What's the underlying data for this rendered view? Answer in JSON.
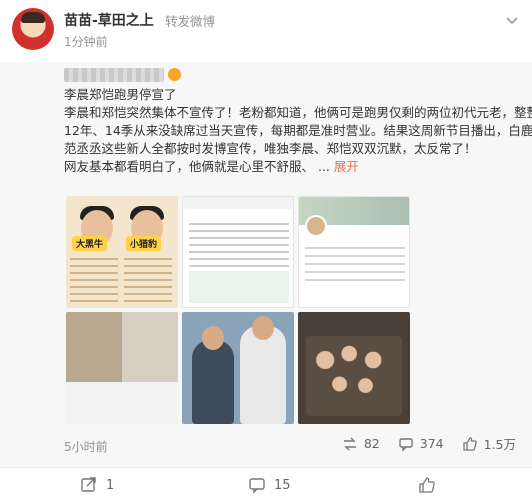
{
  "header": {
    "username": "苗苗-草田之上",
    "repost_label": "转发微博",
    "time": "1分钟前"
  },
  "original": {
    "text_lines": [
      "李晨郑恺跑男停宣了",
      "李晨和郑恺突然集体不宣传了！老粉都知道，他俩可是跑男仅剩的两位初代元老，整整",
      "12年、14季从来没缺席过当天宣传，每期都是准时营业。结果这周新节目播出，白鹿、",
      "范丞丞这些新人全都按时发博宣传，唯独李晨、郑恺双双沉默，太反常了！",
      "网友基本都看明白了，他俩就是心里不舒服、 ..."
    ],
    "expand_label": "展开",
    "thumb1_label_left": "大黑牛",
    "thumb1_label_right": "小猎豹",
    "time": "5小时前",
    "reposts": "82",
    "comments": "374",
    "likes": "1.5万"
  },
  "footer": {
    "repost_count": "1",
    "comment_count": "15"
  },
  "icons": [
    "more-icon",
    "repost-icon",
    "comment-icon",
    "like-icon"
  ],
  "colors": {
    "link": "#eb7350",
    "meta": "#939393",
    "repost_bg": "#f7f7f7"
  }
}
